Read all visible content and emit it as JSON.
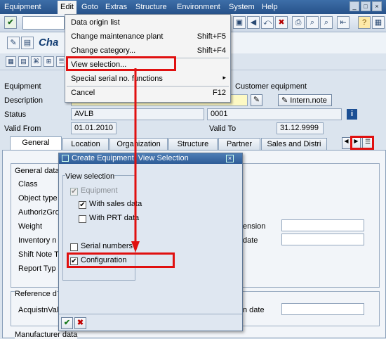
{
  "menubar": {
    "items": [
      "Equipment",
      "Edit",
      "Goto",
      "Extras",
      "Structure",
      "Environment",
      "System",
      "Help"
    ]
  },
  "title": {
    "text": "Cha"
  },
  "edit_menu": {
    "items": [
      {
        "label": "Data origin list",
        "shortcut": ""
      },
      {
        "label": "Change maintenance plant",
        "shortcut": "Shift+F5"
      },
      {
        "label": "Change category...",
        "shortcut": "Shift+F4"
      },
      {
        "label": "View selection...",
        "shortcut": ""
      },
      {
        "label": "Special serial no. functions",
        "shortcut": ""
      },
      {
        "label": "Cancel",
        "shortcut": "F12"
      }
    ]
  },
  "header_form": {
    "equipment_label": "Equipment",
    "customer_equipment_label": "Customer equipment",
    "description_label": "Description",
    "intern_note_button": "Intern.note",
    "status_label": "Status",
    "status_value": "AVLB",
    "status_number": "0001",
    "valid_from_label": "Valid From",
    "valid_from_value": "01.01.2010",
    "valid_to_label": "Valid To",
    "valid_to_value": "31.12.9999"
  },
  "tabs": [
    "General",
    "Location",
    "Organization",
    "Structure",
    "Partner",
    "Sales and Distri"
  ],
  "panel": {
    "general_data_title": "General data",
    "labels": [
      "Class",
      "Object type",
      "AuthorizGro",
      "Weight",
      "Inventory n",
      "Shift Note T",
      "Report Typ"
    ],
    "right_labels": [
      "ension",
      "date"
    ],
    "reference_title": "Reference d",
    "acquisition_label": "AcquistnVal",
    "acquisition_date_label": "n date",
    "manufacturer_title": "Manufacturer data"
  },
  "dialog": {
    "title": "Create Equipment: View Selection",
    "group_title": "View selection",
    "options": [
      {
        "label": "Equipment",
        "checked": true,
        "disabled": true
      },
      {
        "label": "With sales data",
        "checked": true,
        "disabled": false
      },
      {
        "label": "With PRT data",
        "checked": false,
        "disabled": false
      },
      {
        "label": "Serial numbers",
        "checked": false,
        "disabled": false
      },
      {
        "label": "Configuration",
        "checked": true,
        "disabled": false
      }
    ]
  },
  "colors": {
    "menubar": "#2f5d96",
    "highlight": "#e01010",
    "title": "#123d73"
  }
}
